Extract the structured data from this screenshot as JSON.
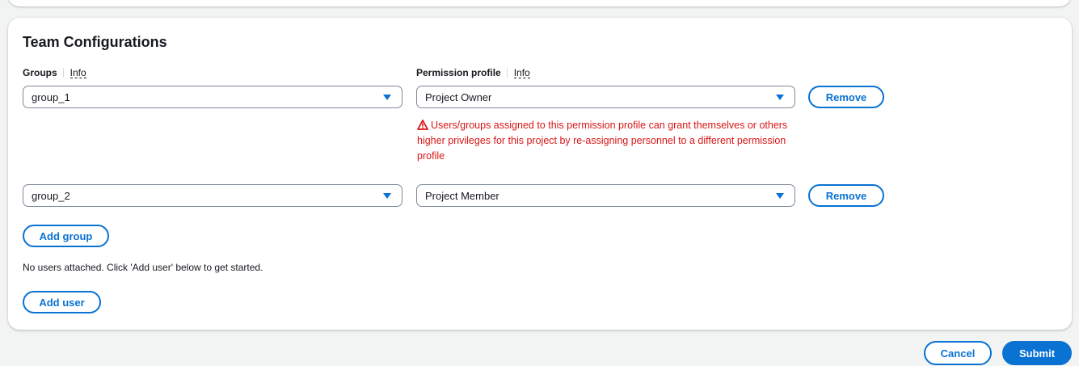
{
  "section": {
    "title": "Team Configurations"
  },
  "groups_field": {
    "label": "Groups",
    "info": "Info"
  },
  "permission_field": {
    "label": "Permission profile",
    "info": "Info"
  },
  "rows": [
    {
      "group": "group_1",
      "permission": "Project Owner",
      "remove_label": "Remove",
      "warning": "Users/groups assigned to this permission profile can grant themselves or others higher privileges for this project by re-assigning personnel to a different permission profile"
    },
    {
      "group": "group_2",
      "permission": "Project Member",
      "remove_label": "Remove"
    }
  ],
  "add_group_label": "Add group",
  "users_empty_text": "No users attached. Click 'Add user' below to get started.",
  "add_user_label": "Add user",
  "footer": {
    "cancel_label": "Cancel",
    "submit_label": "Submit"
  },
  "icons": {
    "caret": "caret-down-icon",
    "warning": "warning-icon"
  },
  "colors": {
    "accent": "#0972d3",
    "error": "#d91515"
  }
}
